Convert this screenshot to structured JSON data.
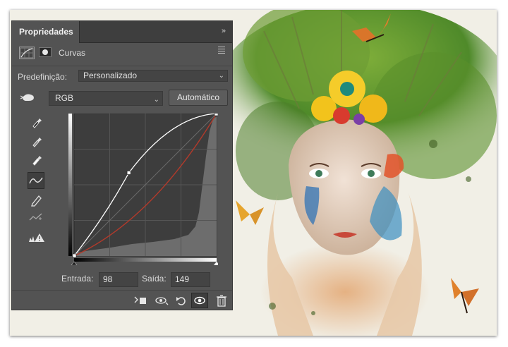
{
  "panel": {
    "tab_label": "Propriedades",
    "collapse_glyph": "»",
    "adjustment_title": "Curvas",
    "preset_label": "Predefinição:",
    "preset_value": "Personalizado",
    "channel_value": "RGB",
    "auto_button_label": "Automático",
    "input_label": "Entrada:",
    "input_value": "98",
    "output_label": "Saída:",
    "output_value": "149"
  },
  "tools": [
    {
      "name": "eyedropper-black-icon"
    },
    {
      "name": "eyedropper-gray-icon"
    },
    {
      "name": "eyedropper-white-icon"
    },
    {
      "name": "curve-points-icon",
      "active": true
    },
    {
      "name": "pencil-icon"
    },
    {
      "name": "smooth-curve-icon"
    },
    {
      "name": "clipping-warning-icon"
    }
  ],
  "curve": {
    "point": {
      "input": 98,
      "output": 149
    },
    "accent_curve_color": "#b23a2b",
    "white_curve_color": "#ffffff"
  },
  "footer_icons": [
    "clip-to-layer-icon",
    "view-previous-state-icon",
    "reset-icon",
    "visibility-eye-icon",
    "trash-icon"
  ],
  "artwork": {
    "description": "Fantasy portrait of a woman with flowers and butterflies"
  }
}
